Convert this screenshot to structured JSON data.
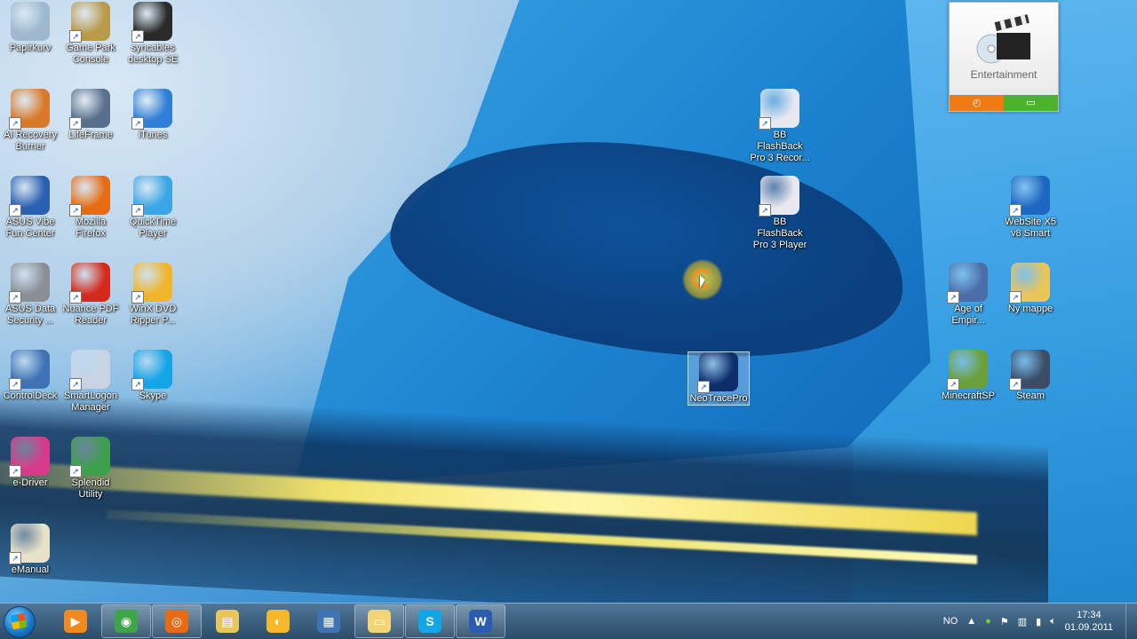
{
  "desktop": {
    "icons": [
      {
        "name": "recycle-bin",
        "label": "Papirkurv",
        "icon": "recycle-bin-icon",
        "color": "#9fb8cf"
      },
      {
        "name": "game-park-console",
        "label": "Game Park Console",
        "icon": "dice-icon",
        "color": "#b89a4a"
      },
      {
        "name": "syncables-desktop",
        "label": "syncables desktop SE",
        "icon": "sync-icon",
        "color": "#2a2a2a"
      },
      {
        "name": "ai-recovery-burner",
        "label": "AI Recovery Burner",
        "icon": "disc-burner-icon",
        "color": "#d87a2a"
      },
      {
        "name": "lifeframe",
        "label": "LifeFrame",
        "icon": "webcam-icon",
        "color": "#5a6f8c"
      },
      {
        "name": "itunes",
        "label": "iTunes",
        "icon": "music-note-icon",
        "color": "#2f7fd6"
      },
      {
        "name": "asus-vibe",
        "label": "ASUS Vibe Fun Center",
        "icon": "vibe-icon",
        "color": "#2b5fb0"
      },
      {
        "name": "mozilla-firefox",
        "label": "Mozilla Firefox",
        "icon": "firefox-icon",
        "color": "#e66b12"
      },
      {
        "name": "quicktime-player",
        "label": "QuickTime Player",
        "icon": "quicktime-icon",
        "color": "#3aa6e6"
      },
      {
        "name": "asus-data-security",
        "label": "ASUS Data Security ...",
        "icon": "lock-gear-icon",
        "color": "#8a8f96"
      },
      {
        "name": "nuance-pdf-reader",
        "label": "Nuance PDF Reader",
        "icon": "pdf-icon",
        "color": "#d42a1c"
      },
      {
        "name": "winx-dvd-ripper",
        "label": "WinX DVD Ripper P...",
        "icon": "dvd-icon",
        "color": "#f0b52a"
      },
      {
        "name": "controldeck",
        "label": "ControlDeck",
        "icon": "control-deck-icon",
        "color": "#3f73b3"
      },
      {
        "name": "smartlogon-manager",
        "label": "SmartLogon Manager",
        "icon": "smartlogon-icon",
        "color": "#c8d4e4"
      },
      {
        "name": "skype",
        "label": "Skype",
        "icon": "skype-icon",
        "color": "#12a5e8"
      },
      {
        "name": "e-driver",
        "label": "e-Driver",
        "icon": "cd-icon",
        "color": "#d83a8a"
      },
      {
        "name": "splendid-utility",
        "label": "Splendid Utility",
        "icon": "splendid-icon",
        "color": "#3da04c"
      },
      {
        "name": "emanual",
        "label": "eManual",
        "icon": "manual-icon",
        "color": "#e8e2c8"
      },
      {
        "name": "bb-flashback-recorder",
        "label": "BB FlashBack Pro 3 Recor...",
        "icon": "flashback-recorder-icon",
        "color": "#e8e8f0"
      },
      {
        "name": "bb-flashback-player",
        "label": "BB FlashBack Pro 3 Player",
        "icon": "flashback-player-icon",
        "color": "#e8e8f0"
      },
      {
        "name": "neotracepro",
        "label": "NeoTracePro",
        "icon": "neotrace-icon",
        "color": "#0c2f6b"
      },
      {
        "name": "website-x5",
        "label": "WebSite X5 v8 Smart",
        "icon": "x5-icon",
        "color": "#1d66c2"
      },
      {
        "name": "age-of-empires",
        "label": "Age of Empir...",
        "icon": "age-of-empires-icon",
        "color": "#4a6fa8"
      },
      {
        "name": "ny-mappe",
        "label": "Ny mappe",
        "icon": "folder-icon",
        "color": "#e9c55a"
      },
      {
        "name": "minecraftsp",
        "label": "MinecraftSP",
        "icon": "grass-block-icon",
        "color": "#6aa03a"
      },
      {
        "name": "steam",
        "label": "Steam",
        "icon": "steam-icon",
        "color": "#3b4d66"
      }
    ]
  },
  "gadget": {
    "title": "Entertainment",
    "left_button": "◴",
    "right_button": "▭"
  },
  "taskbar": {
    "items": [
      {
        "name": "media-player",
        "icon": "media-player-icon",
        "color": "#f08a1e",
        "glyph": "▶",
        "open": false
      },
      {
        "name": "chrome",
        "icon": "chrome-icon",
        "color": "#3ea548",
        "glyph": "◉",
        "open": true
      },
      {
        "name": "firefox",
        "icon": "firefox-icon",
        "color": "#e66b12",
        "glyph": "◎",
        "open": true
      },
      {
        "name": "explorer",
        "icon": "folder-icon",
        "color": "#e9c55a",
        "glyph": "▤",
        "open": false
      },
      {
        "name": "music",
        "icon": "music-disc-icon",
        "color": "#f5b82a",
        "glyph": "◐",
        "open": false
      },
      {
        "name": "network",
        "icon": "network-icon",
        "color": "#3f73b3",
        "glyph": "▦",
        "open": false
      },
      {
        "name": "folder",
        "icon": "folder-open-icon",
        "color": "#f2d574",
        "glyph": "▭",
        "open": true
      },
      {
        "name": "skype",
        "icon": "skype-icon",
        "color": "#12a5e8",
        "glyph": "S",
        "open": true
      },
      {
        "name": "word",
        "icon": "word-icon",
        "color": "#2a5db0",
        "glyph": "W",
        "open": true
      }
    ],
    "tray": {
      "lang": "NO",
      "time": "17:34",
      "date": "01.09.2011"
    }
  }
}
